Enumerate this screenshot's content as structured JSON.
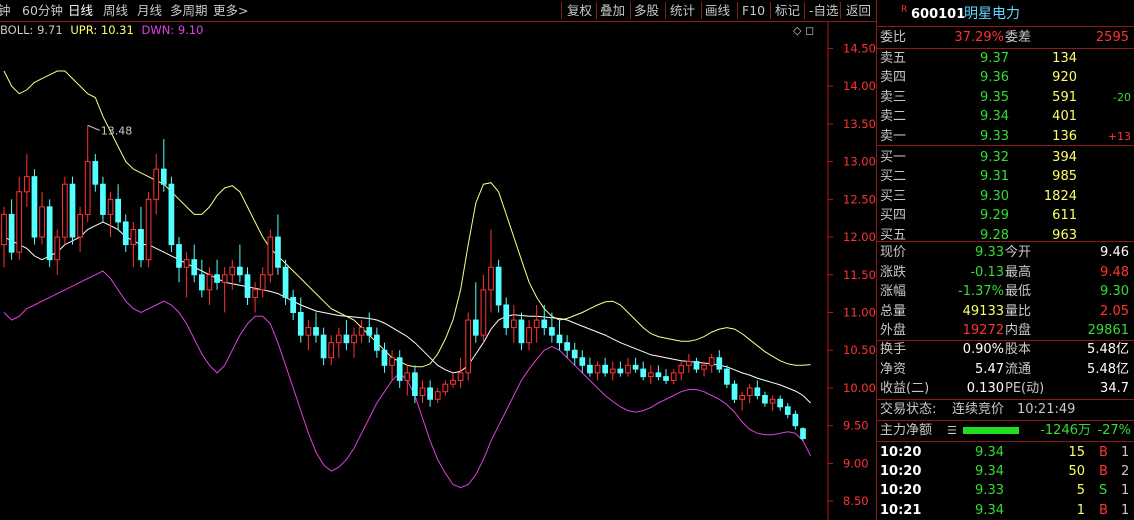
{
  "toolbar": {
    "left_items": [
      "钟",
      "60分钟",
      "日线",
      "周线",
      "月线",
      "多周期",
      "更多>"
    ],
    "active_index": 2,
    "right_items": [
      "复权",
      "叠加",
      "多股",
      "统计",
      "画线",
      "F10",
      "标记",
      "-自选",
      "返回"
    ]
  },
  "indicator": {
    "name": "BOLL: 9.71",
    "upr": "UPR: 10.31",
    "dwn": "DWN: 9.10"
  },
  "corner_icons": "◇ ◻",
  "stock": {
    "badge": "R",
    "code": "600101",
    "name": "明星电力"
  },
  "weibi": {
    "label1": "委比",
    "value1": "37.29%",
    "label2": "委差",
    "value2": "2595"
  },
  "orderbook": {
    "sell": [
      {
        "label": "卖五",
        "price": "9.37",
        "vol": "134",
        "chg": ""
      },
      {
        "label": "卖四",
        "price": "9.36",
        "vol": "920",
        "chg": ""
      },
      {
        "label": "卖三",
        "price": "9.35",
        "vol": "591",
        "chg": "-20"
      },
      {
        "label": "卖二",
        "price": "9.34",
        "vol": "401",
        "chg": ""
      },
      {
        "label": "卖一",
        "price": "9.33",
        "vol": "136",
        "chg": "+13"
      }
    ],
    "buy": [
      {
        "label": "买一",
        "price": "9.32",
        "vol": "394",
        "chg": ""
      },
      {
        "label": "买二",
        "price": "9.31",
        "vol": "985",
        "chg": ""
      },
      {
        "label": "买三",
        "price": "9.30",
        "vol": "1824",
        "chg": ""
      },
      {
        "label": "买四",
        "price": "9.29",
        "vol": "611",
        "chg": ""
      },
      {
        "label": "买五",
        "price": "9.28",
        "vol": "963",
        "chg": ""
      }
    ]
  },
  "quote": [
    {
      "l1": "现价",
      "v1": "9.33",
      "c1": "green",
      "l2": "今开",
      "v2": "9.46",
      "c2": "white"
    },
    {
      "l1": "涨跌",
      "v1": "-0.13",
      "c1": "green",
      "l2": "最高",
      "v2": "9.48",
      "c2": "red"
    },
    {
      "l1": "涨幅",
      "v1": "-1.37%",
      "c1": "green",
      "l2": "最低",
      "v2": "9.30",
      "c2": "green"
    },
    {
      "l1": "总量",
      "v1": "49133",
      "c1": "yellow",
      "l2": "量比",
      "v2": "2.05",
      "c2": "red"
    },
    {
      "l1": "外盘",
      "v1": "19272",
      "c1": "red",
      "l2": "内盘",
      "v2": "29861",
      "c2": "green"
    }
  ],
  "fundamentals": [
    {
      "l1": "换手",
      "v1": "0.90%",
      "l2": "股本",
      "v2": "5.48亿"
    },
    {
      "l1": "净资",
      "v1": "5.47",
      "l2": "流通",
      "v2": "5.48亿"
    },
    {
      "l1": "收益(二)",
      "v1": "0.130",
      "l2": "PE(动)",
      "v2": "34.7"
    }
  ],
  "trade_status": {
    "label": "交易状态:",
    "value": "连续竞价",
    "time": "10:21:49"
  },
  "main_force": {
    "label": "主力净额",
    "amount": "-1246万",
    "pct": "-27%"
  },
  "ticks": [
    {
      "time": "10:20",
      "price": "9.34",
      "vol": "15",
      "side": "B",
      "n": "1"
    },
    {
      "time": "10:20",
      "price": "9.34",
      "vol": "50",
      "side": "B",
      "n": "2"
    },
    {
      "time": "10:20",
      "price": "9.33",
      "vol": "5",
      "side": "S",
      "n": "1"
    },
    {
      "time": "10:21",
      "price": "9.34",
      "vol": "1",
      "side": "B",
      "n": "1"
    }
  ],
  "colors": {
    "up": "#ff3333",
    "down": "#54ffff",
    "mid": "#ffffff",
    "upper": "#ffff88",
    "lower": "#e040e0",
    "axis": "#b01c1c"
  },
  "chart_data": {
    "type": "candlestick",
    "y_ticks": [
      "14.50",
      "14.00",
      "13.50",
      "13.00",
      "12.50",
      "12.00",
      "11.50",
      "11.00",
      "10.50",
      "10.00",
      "9.50",
      "9.00",
      "8.50"
    ],
    "ylim": [
      8.25,
      14.85
    ],
    "high_label": "13.48",
    "candles": [
      [
        11.9,
        12.4,
        11.6,
        12.3
      ],
      [
        12.3,
        12.5,
        11.7,
        11.8
      ],
      [
        11.8,
        12.8,
        11.7,
        12.6
      ],
      [
        12.6,
        13.1,
        12.4,
        12.8
      ],
      [
        12.8,
        12.9,
        11.9,
        12.0
      ],
      [
        12.0,
        12.6,
        11.9,
        12.4
      ],
      [
        12.4,
        12.5,
        11.6,
        11.7
      ],
      [
        11.7,
        12.1,
        11.5,
        12.0
      ],
      [
        12.0,
        12.8,
        11.9,
        12.7
      ],
      [
        12.7,
        12.8,
        11.9,
        12.0
      ],
      [
        12.0,
        12.4,
        11.8,
        12.3
      ],
      [
        12.3,
        13.48,
        12.2,
        13.0
      ],
      [
        13.0,
        13.1,
        12.6,
        12.7
      ],
      [
        12.7,
        12.8,
        12.2,
        12.3
      ],
      [
        12.3,
        12.6,
        12.0,
        12.5
      ],
      [
        12.5,
        12.7,
        12.1,
        12.2
      ],
      [
        12.2,
        12.3,
        11.8,
        11.9
      ],
      [
        11.9,
        12.2,
        11.6,
        12.1
      ],
      [
        12.1,
        12.4,
        11.6,
        11.7
      ],
      [
        11.7,
        12.6,
        11.6,
        12.5
      ],
      [
        12.5,
        13.1,
        12.3,
        12.9
      ],
      [
        12.9,
        13.3,
        12.6,
        12.7
      ],
      [
        12.7,
        12.8,
        11.8,
        11.9
      ],
      [
        11.9,
        12.0,
        11.4,
        11.6
      ],
      [
        11.6,
        11.8,
        11.2,
        11.7
      ],
      [
        11.7,
        11.9,
        11.4,
        11.5
      ],
      [
        11.5,
        11.7,
        11.2,
        11.3
      ],
      [
        11.3,
        11.6,
        11.1,
        11.5
      ],
      [
        11.5,
        11.7,
        11.3,
        11.4
      ],
      [
        11.4,
        11.6,
        11.0,
        11.5
      ],
      [
        11.5,
        11.7,
        11.3,
        11.6
      ],
      [
        11.6,
        11.9,
        11.4,
        11.5
      ],
      [
        11.5,
        11.6,
        11.1,
        11.2
      ],
      [
        11.2,
        11.4,
        11.0,
        11.3
      ],
      [
        11.3,
        11.6,
        11.2,
        11.5
      ],
      [
        11.5,
        12.1,
        11.4,
        12.0
      ],
      [
        12.0,
        12.3,
        11.5,
        11.6
      ],
      [
        11.6,
        11.7,
        11.1,
        11.2
      ],
      [
        11.2,
        11.3,
        10.9,
        11.0
      ],
      [
        11.0,
        11.2,
        10.6,
        10.7
      ],
      [
        10.7,
        10.9,
        10.5,
        10.8
      ],
      [
        10.8,
        11.0,
        10.6,
        10.7
      ],
      [
        10.7,
        10.8,
        10.3,
        10.4
      ],
      [
        10.4,
        10.7,
        10.3,
        10.6
      ],
      [
        10.6,
        10.8,
        10.4,
        10.7
      ],
      [
        10.7,
        10.9,
        10.5,
        10.6
      ],
      [
        10.6,
        10.8,
        10.4,
        10.7
      ],
      [
        10.7,
        10.9,
        10.6,
        10.8
      ],
      [
        10.8,
        11.0,
        10.6,
        10.7
      ],
      [
        10.7,
        10.8,
        10.4,
        10.5
      ],
      [
        10.5,
        10.6,
        10.2,
        10.3
      ],
      [
        10.3,
        10.5,
        10.1,
        10.4
      ],
      [
        10.4,
        10.5,
        10.0,
        10.1
      ],
      [
        10.1,
        10.3,
        9.9,
        10.2
      ],
      [
        10.2,
        10.3,
        9.8,
        9.9
      ],
      [
        9.9,
        10.1,
        9.8,
        10.0
      ],
      [
        10.0,
        10.1,
        9.75,
        9.85
      ],
      [
        9.85,
        10.0,
        9.8,
        9.95
      ],
      [
        9.95,
        10.1,
        9.9,
        10.05
      ],
      [
        10.05,
        10.2,
        10.0,
        10.1
      ],
      [
        10.1,
        10.4,
        10.0,
        10.2
      ],
      [
        10.2,
        11.0,
        10.1,
        10.9
      ],
      [
        10.9,
        11.4,
        10.6,
        10.7
      ],
      [
        10.7,
        11.5,
        10.6,
        11.3
      ],
      [
        11.3,
        12.1,
        11.0,
        11.6
      ],
      [
        11.6,
        11.7,
        11.0,
        11.1
      ],
      [
        11.1,
        11.2,
        10.7,
        10.8
      ],
      [
        10.8,
        11.1,
        10.6,
        10.9
      ],
      [
        10.9,
        11.0,
        10.5,
        10.6
      ],
      [
        10.6,
        10.9,
        10.5,
        10.8
      ],
      [
        10.8,
        11.1,
        10.6,
        10.9
      ],
      [
        10.9,
        11.1,
        10.7,
        10.8
      ],
      [
        10.8,
        11.0,
        10.6,
        10.7
      ],
      [
        10.7,
        10.9,
        10.5,
        10.6
      ],
      [
        10.6,
        10.7,
        10.4,
        10.5
      ],
      [
        10.5,
        10.6,
        10.3,
        10.4
      ],
      [
        10.4,
        10.5,
        10.2,
        10.3
      ],
      [
        10.3,
        10.4,
        10.15,
        10.2
      ],
      [
        10.2,
        10.35,
        10.1,
        10.3
      ],
      [
        10.3,
        10.4,
        10.15,
        10.2
      ],
      [
        10.2,
        10.35,
        10.1,
        10.25
      ],
      [
        10.25,
        10.35,
        10.15,
        10.2
      ],
      [
        10.2,
        10.4,
        10.15,
        10.3
      ],
      [
        10.3,
        10.4,
        10.2,
        10.25
      ],
      [
        10.25,
        10.35,
        10.1,
        10.15
      ],
      [
        10.15,
        10.3,
        10.05,
        10.2
      ],
      [
        10.2,
        10.3,
        10.1,
        10.15
      ],
      [
        10.15,
        10.25,
        10.05,
        10.1
      ],
      [
        10.1,
        10.25,
        10.05,
        10.2
      ],
      [
        10.2,
        10.35,
        10.1,
        10.3
      ],
      [
        10.3,
        10.45,
        10.2,
        10.35
      ],
      [
        10.35,
        10.4,
        10.2,
        10.25
      ],
      [
        10.25,
        10.35,
        10.15,
        10.3
      ],
      [
        10.3,
        10.45,
        10.2,
        10.4
      ],
      [
        10.4,
        10.5,
        10.2,
        10.25
      ],
      [
        10.25,
        10.3,
        10.0,
        10.05
      ],
      [
        10.05,
        10.1,
        9.8,
        9.85
      ],
      [
        9.85,
        9.95,
        9.7,
        9.9
      ],
      [
        9.9,
        10.05,
        9.8,
        10.0
      ],
      [
        10.0,
        10.1,
        9.85,
        9.9
      ],
      [
        9.9,
        9.95,
        9.75,
        9.8
      ],
      [
        9.8,
        9.9,
        9.7,
        9.85
      ],
      [
        9.85,
        9.9,
        9.7,
        9.75
      ],
      [
        9.75,
        9.8,
        9.6,
        9.65
      ],
      [
        9.65,
        9.7,
        9.45,
        9.5
      ],
      [
        9.46,
        9.48,
        9.3,
        9.33
      ]
    ],
    "mid": [
      12.0,
      11.95,
      11.9,
      11.85,
      11.75,
      11.7,
      11.75,
      11.8,
      11.9,
      11.95,
      12.0,
      12.1,
      12.15,
      12.2,
      12.15,
      12.1,
      12.0,
      11.95,
      11.9,
      11.9,
      11.85,
      11.8,
      11.75,
      11.7,
      11.65,
      11.6,
      11.55,
      11.5,
      11.45,
      11.4,
      11.38,
      11.36,
      11.34,
      11.32,
      11.3,
      11.28,
      11.25,
      11.2,
      11.15,
      11.1,
      11.06,
      11.02,
      11.0,
      10.98,
      10.96,
      10.95,
      10.94,
      10.93,
      10.92,
      10.9,
      10.86,
      10.8,
      10.74,
      10.68,
      10.6,
      10.5,
      10.4,
      10.3,
      10.24,
      10.2,
      10.22,
      10.3,
      10.45,
      10.6,
      10.78,
      10.9,
      10.95,
      10.97,
      10.96,
      10.95,
      10.95,
      10.94,
      10.93,
      10.92,
      10.9,
      10.86,
      10.82,
      10.78,
      10.74,
      10.7,
      10.65,
      10.6,
      10.56,
      10.52,
      10.48,
      10.44,
      10.42,
      10.4,
      10.38,
      10.36,
      10.35,
      10.34,
      10.33,
      10.32,
      10.3,
      10.28,
      10.24,
      10.2,
      10.17,
      10.13,
      10.1,
      10.07,
      10.04,
      10.0,
      9.96,
      9.9,
      9.8
    ],
    "upper": [
      14.2,
      14.0,
      13.9,
      13.95,
      14.05,
      14.1,
      14.15,
      14.2,
      14.2,
      14.1,
      14.0,
      13.9,
      13.85,
      13.6,
      13.4,
      13.2,
      13.0,
      12.9,
      12.85,
      12.8,
      12.75,
      12.7,
      12.6,
      12.5,
      12.4,
      12.3,
      12.3,
      12.4,
      12.55,
      12.65,
      12.68,
      12.6,
      12.4,
      12.2,
      12.0,
      11.85,
      11.75,
      11.65,
      11.55,
      11.45,
      11.35,
      11.25,
      11.15,
      11.05,
      11.0,
      10.95,
      10.9,
      10.8,
      10.7,
      10.6,
      10.5,
      10.4,
      10.35,
      10.3,
      10.28,
      10.28,
      10.32,
      10.45,
      10.65,
      10.9,
      11.3,
      11.9,
      12.45,
      12.7,
      12.72,
      12.6,
      12.3,
      12.0,
      11.7,
      11.4,
      11.2,
      11.05,
      10.95,
      10.9,
      10.92,
      10.96,
      11.0,
      11.05,
      11.1,
      11.14,
      11.15,
      11.1,
      11.0,
      10.9,
      10.8,
      10.72,
      10.68,
      10.66,
      10.64,
      10.62,
      10.62,
      10.64,
      10.68,
      10.74,
      10.78,
      10.8,
      10.78,
      10.72,
      10.64,
      10.56,
      10.48,
      10.42,
      10.36,
      10.32,
      10.3,
      10.3,
      10.31
    ],
    "lower": [
      11.0,
      10.9,
      10.95,
      11.05,
      11.1,
      11.15,
      11.2,
      11.25,
      11.3,
      11.35,
      11.4,
      11.45,
      11.5,
      11.55,
      11.45,
      11.3,
      11.15,
      11.05,
      11.0,
      11.05,
      11.1,
      11.15,
      11.1,
      11.0,
      10.85,
      10.65,
      10.45,
      10.3,
      10.2,
      10.3,
      10.5,
      10.7,
      10.85,
      10.95,
      10.95,
      10.85,
      10.6,
      10.3,
      10.0,
      9.7,
      9.4,
      9.15,
      8.98,
      8.9,
      8.95,
      9.05,
      9.2,
      9.4,
      9.6,
      9.8,
      9.95,
      10.1,
      10.2,
      10.1,
      9.9,
      9.6,
      9.3,
      9.05,
      8.87,
      8.72,
      8.68,
      8.72,
      8.85,
      9.05,
      9.3,
      9.5,
      9.7,
      9.9,
      10.1,
      10.25,
      10.38,
      10.5,
      10.55,
      10.5,
      10.4,
      10.3,
      10.2,
      10.1,
      10.0,
      9.9,
      9.82,
      9.75,
      9.7,
      9.68,
      9.7,
      9.74,
      9.8,
      9.85,
      9.9,
      9.95,
      9.98,
      9.98,
      9.95,
      9.9,
      9.85,
      9.78,
      9.68,
      9.55,
      9.45,
      9.4,
      9.38,
      9.38,
      9.4,
      9.42,
      9.4,
      9.3,
      9.1
    ]
  }
}
